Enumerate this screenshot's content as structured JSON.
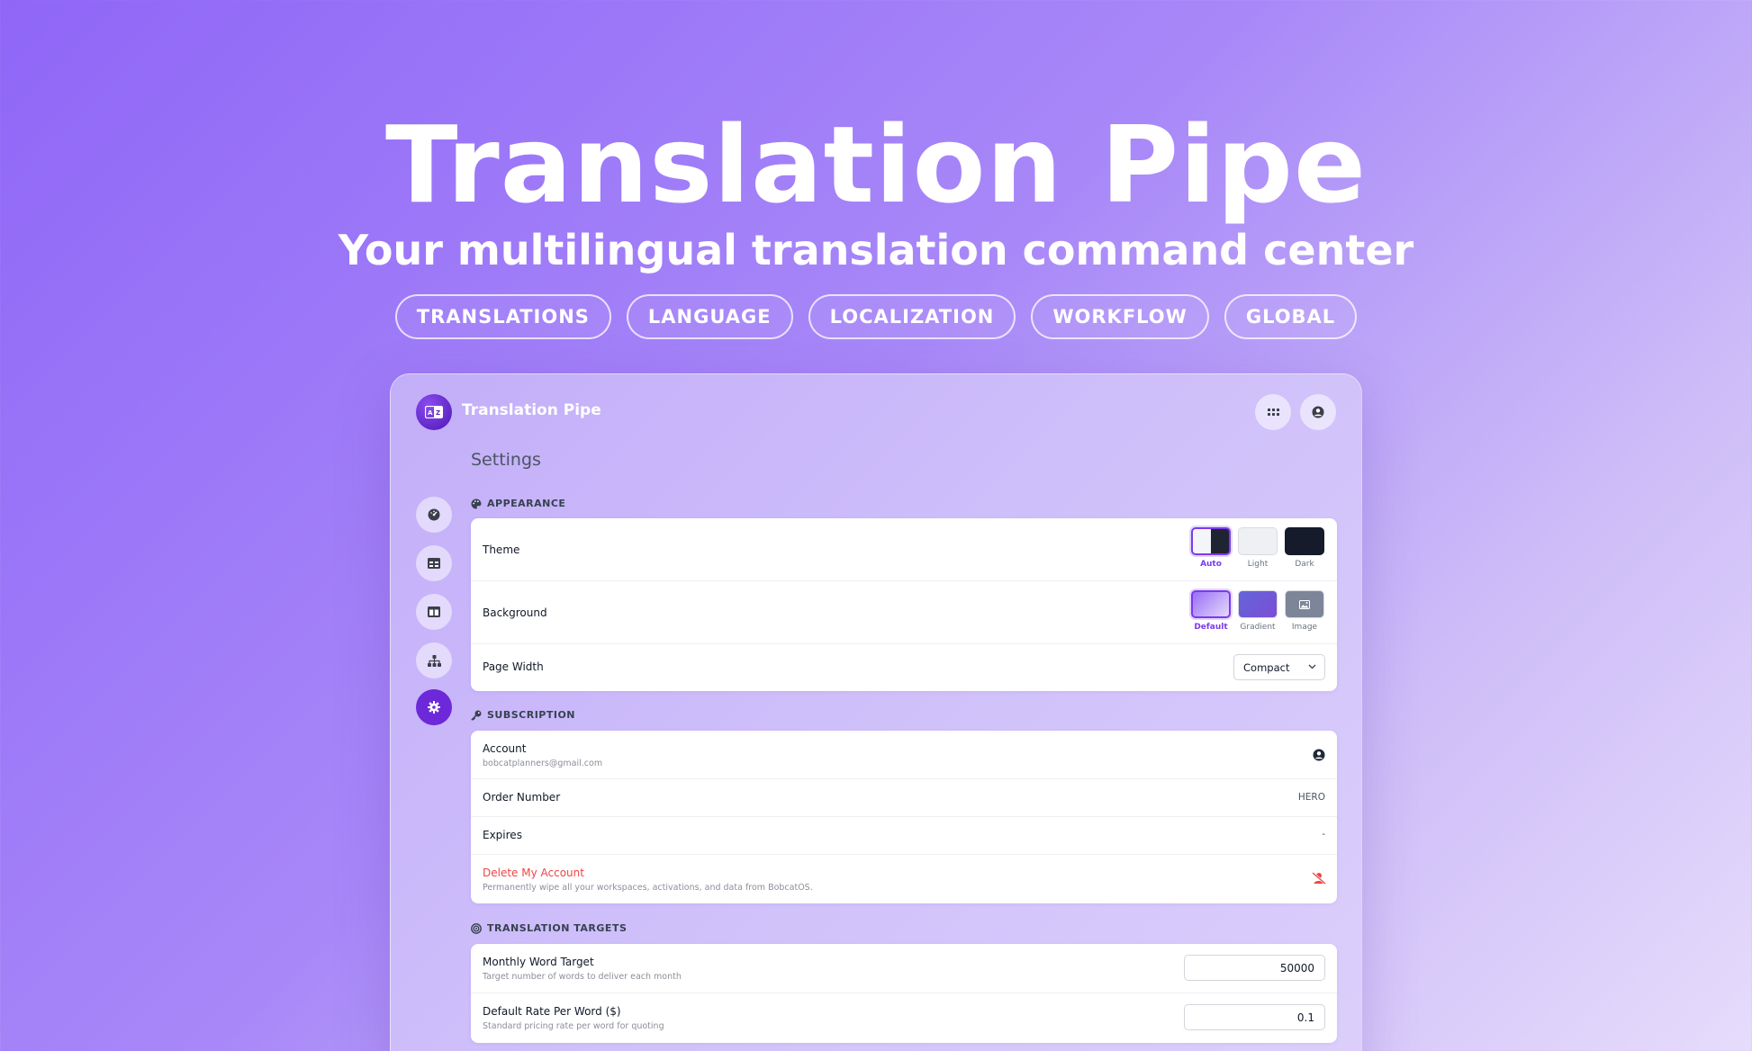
{
  "hero": {
    "title": "Translation Pipe",
    "subtitle": "Your multilingual translation command center",
    "tags": [
      "TRANSLATIONS",
      "LANGUAGE",
      "LOCALIZATION",
      "WORKFLOW",
      "GLOBAL"
    ]
  },
  "app": {
    "name": "Translation Pipe",
    "page_title": "Settings",
    "icons": {
      "logo": "translate-icon",
      "apps": "grid-icon",
      "user": "user-circle-icon",
      "sidebar": [
        "dashboard-icon",
        "table-icon",
        "columns-icon",
        "sitemap-icon",
        "gear-icon"
      ]
    },
    "accent": "#6d28d9"
  },
  "appearance": {
    "heading": "APPEARANCE",
    "theme_label": "Theme",
    "theme_options": [
      "Auto",
      "Light",
      "Dark"
    ],
    "theme_selected": "Auto",
    "background_label": "Background",
    "background_options": [
      "Default",
      "Gradient",
      "Image"
    ],
    "background_selected": "Default",
    "page_width_label": "Page Width",
    "page_width_value": "Compact"
  },
  "subscription": {
    "heading": "SUBSCRIPTION",
    "account_label": "Account",
    "account_email": "bobcatplanners@gmail.com",
    "order_label": "Order Number",
    "order_value": "HERO",
    "expires_label": "Expires",
    "expires_value": "-",
    "delete_label": "Delete My Account",
    "delete_desc": "Permanently wipe all your workspaces, activations, and data from BobcatOS.",
    "danger_color": "#ef4444"
  },
  "targets": {
    "heading": "TRANSLATION TARGETS",
    "monthly_label": "Monthly Word Target",
    "monthly_desc": "Target number of words to deliver each month",
    "monthly_value": "50000",
    "rate_label": "Default Rate Per Word ($)",
    "rate_desc": "Standard pricing rate per word for quoting",
    "rate_value": "0.1"
  }
}
